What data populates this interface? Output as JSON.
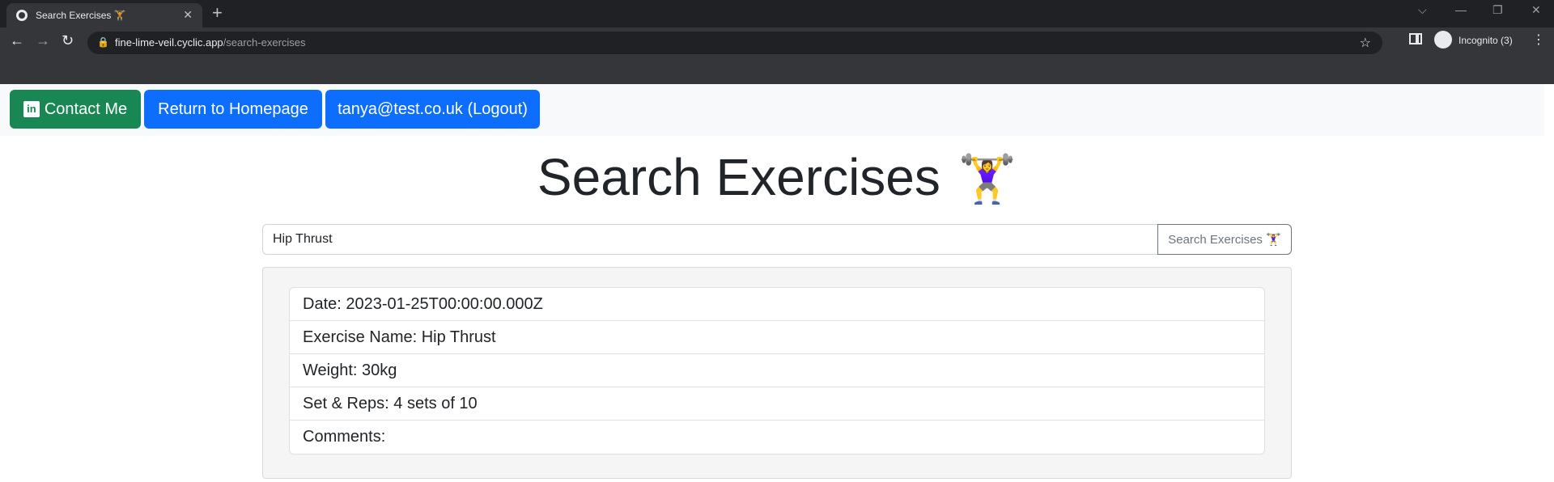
{
  "browser": {
    "tab_title": "Search Exercises 🏋",
    "tab_close": "✕",
    "new_tab": "+",
    "url_host": "fine-lime-veil.cyclic.app",
    "url_path": "/search-exercises",
    "incognito_label": "Incognito (3)"
  },
  "navbar": {
    "contact_label": "Contact Me",
    "home_label": "Return to Homepage",
    "logout_label": "tanya@test.co.uk (Logout)"
  },
  "main": {
    "title": "Search Exercises",
    "title_emoji": "🏋️‍♀️",
    "search_value": "Hip Thrust",
    "search_button": "Search Exercises 🏋️‍♀️"
  },
  "results": [
    "Date: 2023-01-25T00:00:00.000Z",
    "Exercise Name: Hip Thrust",
    "Weight: 30kg",
    "Set & Reps: 4 sets of 10",
    "Comments:"
  ],
  "colors": {
    "chrome_dark": "#202124",
    "chrome_toolbar": "#35363a",
    "btn_green": "#198754",
    "btn_blue": "#0d6efd"
  }
}
